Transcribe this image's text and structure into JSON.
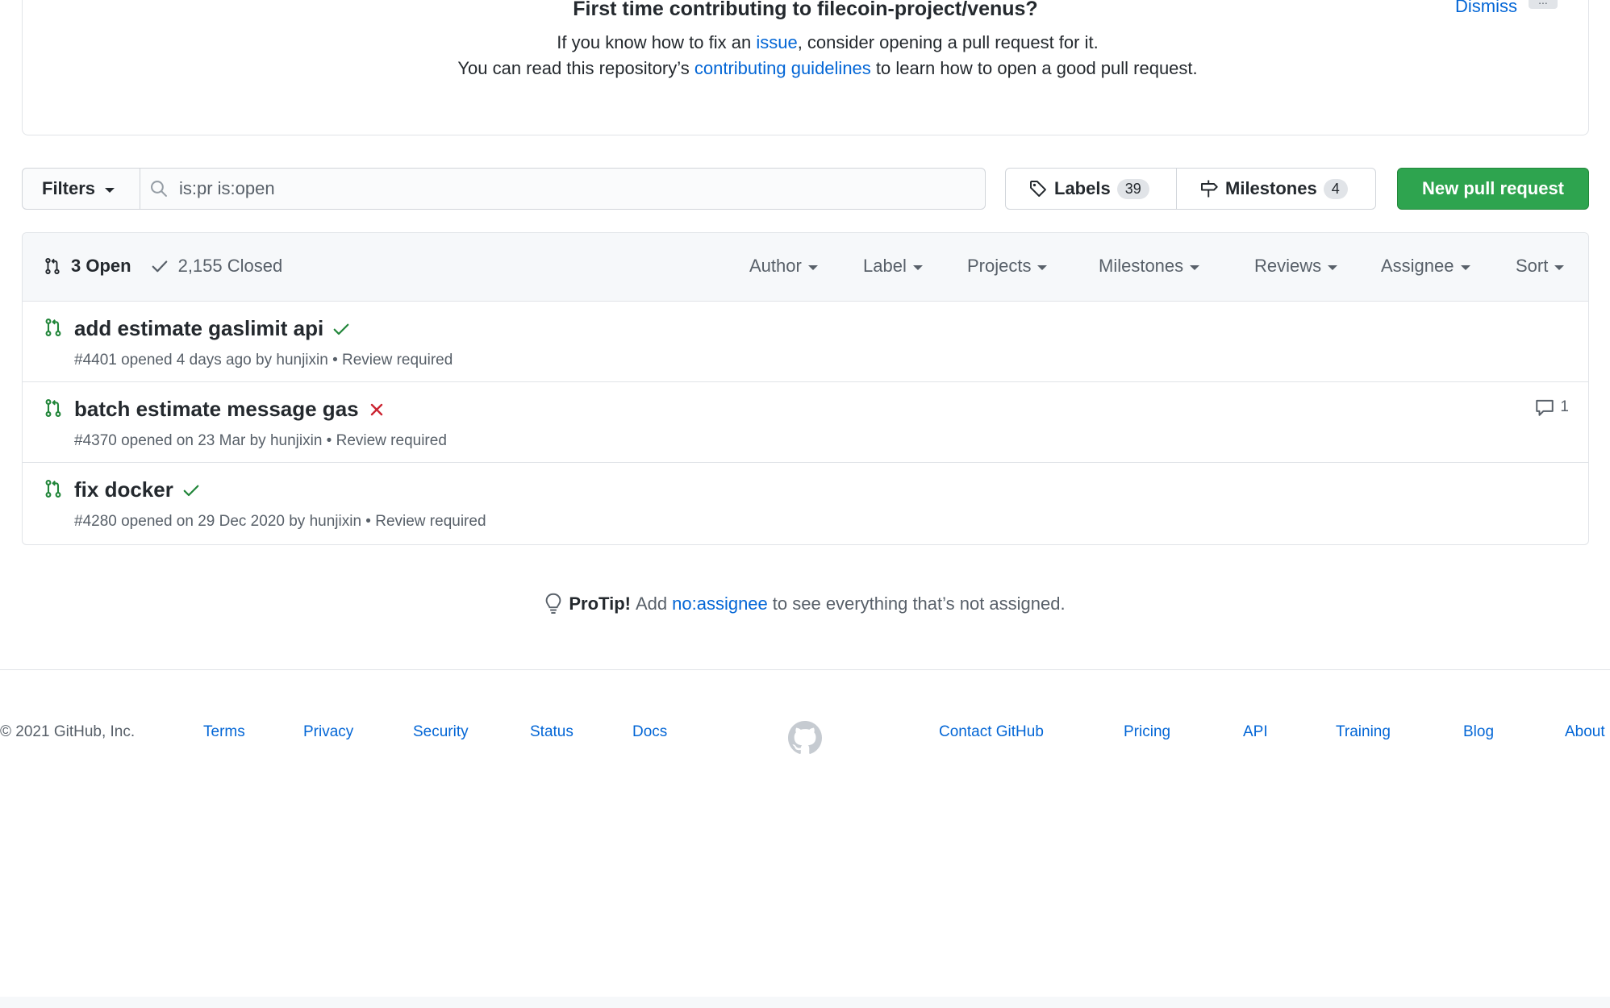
{
  "banner": {
    "title": "First time contributing to filecoin-project/venus?",
    "line1_before": "If you know how to fix an ",
    "line1_link": "issue",
    "line1_after": ", consider opening a pull request for it.",
    "line2_before": "You can read this repository’s ",
    "line2_link": "contributing guidelines",
    "line2_after": " to learn how to open a good pull request.",
    "dismiss": "Dismiss",
    "more": "..."
  },
  "toolbar": {
    "filters_label": "Filters",
    "search_value": "is:pr is:open",
    "labels_label": "Labels",
    "labels_count": "39",
    "milestones_label": "Milestones",
    "milestones_count": "4",
    "new_pr_label": "New pull request"
  },
  "list": {
    "open_label": "3 Open",
    "closed_label": "2,155 Closed",
    "menus": [
      "Author",
      "Label",
      "Projects",
      "Milestones",
      "Reviews",
      "Assignee",
      "Sort"
    ],
    "items": [
      {
        "title": "add estimate gaslimit api",
        "status": "success",
        "meta": "#4401 opened 4 days ago by hunjixin • Review required",
        "comments": ""
      },
      {
        "title": "batch estimate message gas",
        "status": "failure",
        "meta": "#4370 opened on 23 Mar by hunjixin • Review required",
        "comments": "1"
      },
      {
        "title": "fix docker",
        "status": "success",
        "meta": "#4280 opened on 29 Dec 2020 by hunjixin • Review required",
        "comments": ""
      }
    ]
  },
  "protip": {
    "label": "ProTip!",
    "before": "Add",
    "link": "no:assignee",
    "after": "to see everything that’s not assigned."
  },
  "footer": {
    "copyright": "© 2021 GitHub, Inc.",
    "left_links": [
      "Terms",
      "Privacy",
      "Security",
      "Status",
      "Docs"
    ],
    "right_links": [
      "Contact GitHub",
      "Pricing",
      "API",
      "Training",
      "Blog",
      "About"
    ]
  },
  "colors": {
    "link": "#0366d6",
    "green": "#2ea44f",
    "success": "#22863a",
    "failure": "#cb2431",
    "muted": "#586069"
  }
}
